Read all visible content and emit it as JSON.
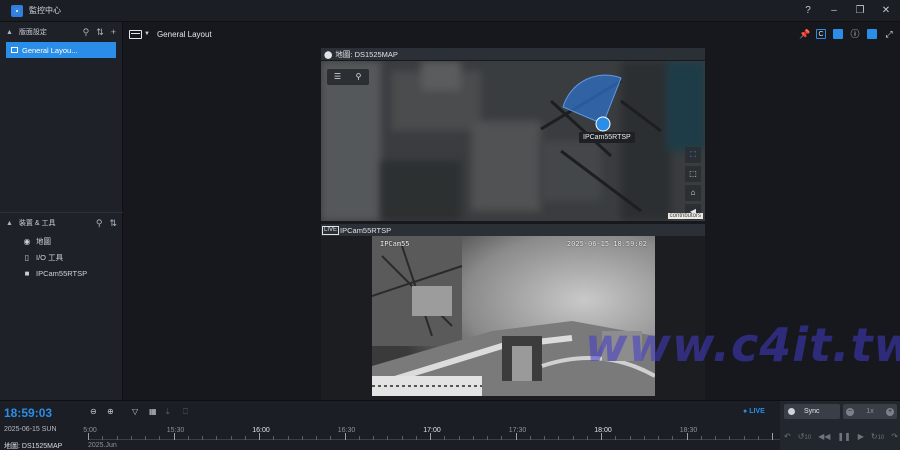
{
  "app": {
    "title": "監控中心"
  },
  "window_controls": [
    "?",
    "–",
    "❐",
    "✕"
  ],
  "sidebar": {
    "layouts_header": "版面設定",
    "layouts": [
      {
        "label": "General Layou..."
      }
    ],
    "devices_header": "裝置 & 工具",
    "devices": [
      {
        "label": "地圖",
        "icon": "map-icon"
      },
      {
        "label": "I/O 工具",
        "icon": "io-icon"
      },
      {
        "label": "IPCam55RTSP",
        "icon": "camera-icon"
      }
    ]
  },
  "toolbar": {
    "layout_title": "General Layout",
    "display_mode": "C"
  },
  "map_pane": {
    "title": "地圖: DS1525MAP",
    "camera_label": "IPCam55RTSP",
    "attribution": "contributors"
  },
  "live_pane": {
    "badge": "LIVE",
    "title": "IPCam55RTSP",
    "osd_name": "IPCam55",
    "osd_timestamp": "2025-06-15 18:59:02"
  },
  "timeline": {
    "clock": "18:59:03",
    "date": "2025-06-15 SUN",
    "source": "地圖: DS1525MAP",
    "live_label": "LIVE",
    "year_label": "2025.Jun",
    "ticks": [
      {
        "label": "5:00",
        "major": false
      },
      {
        "label": "15:30",
        "major": false
      },
      {
        "label": "16:00",
        "major": true
      },
      {
        "label": "16:30",
        "major": false
      },
      {
        "label": "17:00",
        "major": true
      },
      {
        "label": "17:30",
        "major": false
      },
      {
        "label": "18:00",
        "major": true
      },
      {
        "label": "18:30",
        "major": false
      }
    ]
  },
  "playback": {
    "sync_label": "Sync",
    "speed_label": "1x",
    "skip_back": "10",
    "skip_fwd": "10"
  },
  "watermark": "www.c4it.tw",
  "colors": {
    "accent": "#2a8ee8",
    "background": "#16181d",
    "panel": "#1e2127"
  }
}
